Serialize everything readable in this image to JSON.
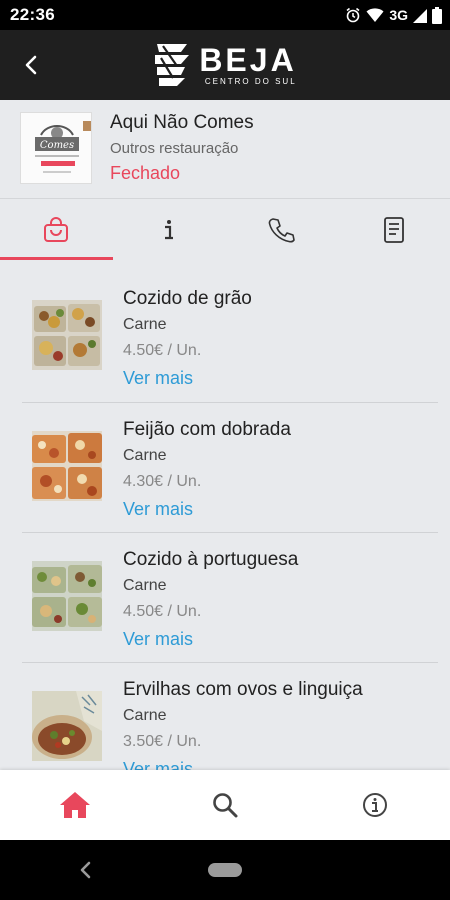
{
  "status_bar": {
    "time": "22:36",
    "network": "3G"
  },
  "header": {
    "logo_title": "BEJA",
    "logo_subtitle": "CENTRO DO SUL"
  },
  "business": {
    "name": "Aqui Não Comes",
    "category": "Outros restauração",
    "status": "Fechado",
    "thumb_text": "Comes"
  },
  "tabs": [
    {
      "icon": "shopping-bag-icon",
      "active": true
    },
    {
      "icon": "info-icon",
      "active": false
    },
    {
      "icon": "phone-icon",
      "active": false
    },
    {
      "icon": "document-icon",
      "active": false
    }
  ],
  "items": [
    {
      "name": "Cozido de grão",
      "category": "Carne",
      "price": "4.50€ / Un.",
      "more": "Ver mais"
    },
    {
      "name": "Feijão com dobrada",
      "category": "Carne",
      "price": "4.30€ / Un.",
      "more": "Ver mais"
    },
    {
      "name": "Cozido à portuguesa",
      "category": "Carne",
      "price": "4.50€ / Un.",
      "more": "Ver mais"
    },
    {
      "name": "Ervilhas com ovos e linguiça",
      "category": "Carne",
      "price": "3.50€ / Un.",
      "more": "Ver mais"
    }
  ],
  "bottom_nav": [
    {
      "icon": "home-icon",
      "active": true
    },
    {
      "icon": "search-icon",
      "active": false
    },
    {
      "icon": "info-circle-icon",
      "active": false
    }
  ],
  "colors": {
    "accent": "#e8475c",
    "link": "#2e9bd6",
    "header_bg": "#1f1f1f",
    "page_bg": "#e8eaed"
  }
}
